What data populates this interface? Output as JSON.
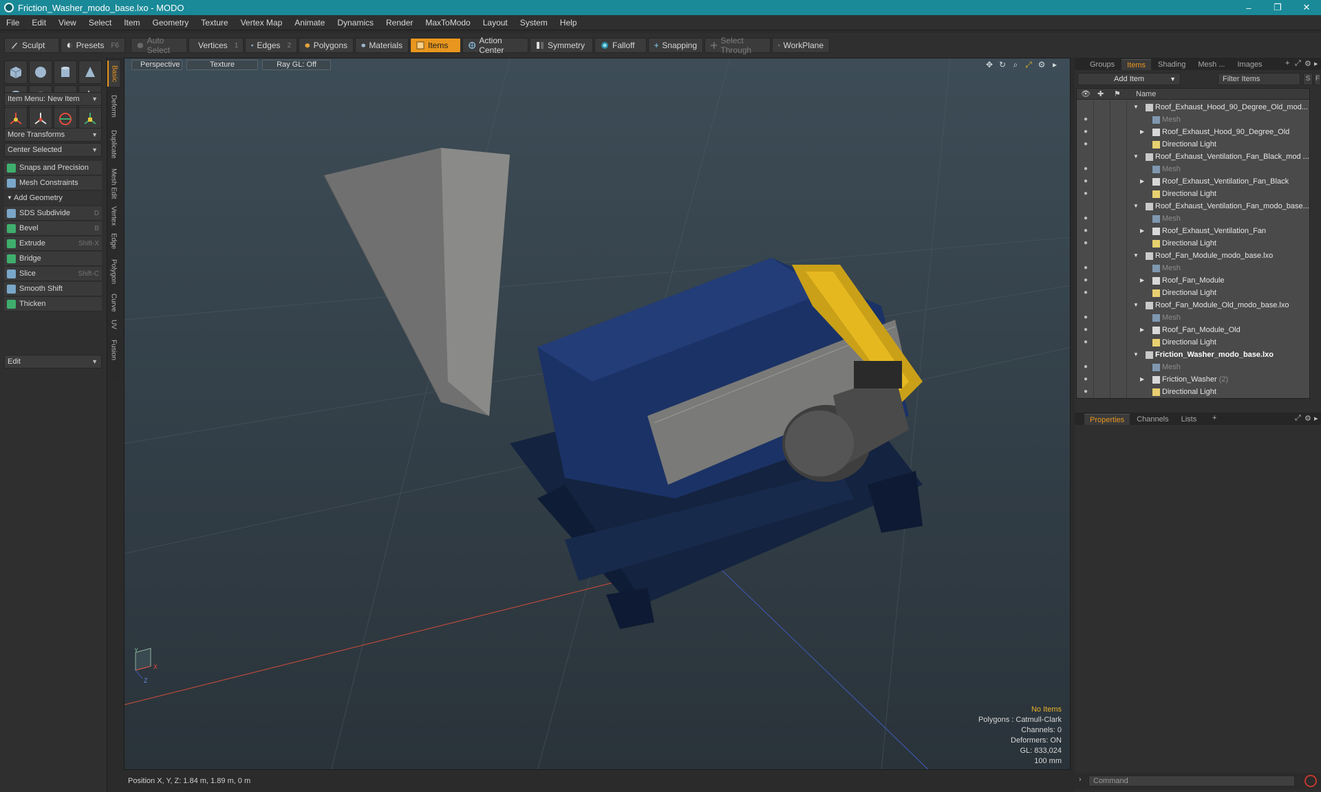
{
  "window": {
    "title": "Friction_Washer_modo_base.lxo - MODO",
    "minimize": "–",
    "maximize": "❐",
    "close": "✕"
  },
  "menus": [
    "File",
    "Edit",
    "View",
    "Select",
    "Item",
    "Geometry",
    "Texture",
    "Vertex Map",
    "Animate",
    "Dynamics",
    "Render",
    "MaxToModo",
    "Layout",
    "System",
    "Help"
  ],
  "toolbar": {
    "sculpt": "Sculpt",
    "presets": "Presets",
    "presets_key": "F6",
    "auto_select": "Auto Select",
    "vertices": "Vertices",
    "vertices_key": "1",
    "edges": "Edges",
    "edges_key": "2",
    "polygons": "Polygons",
    "materials": "Materials",
    "items": "Items",
    "action_center": "Action Center",
    "symmetry": "Symmetry",
    "falloff": "Falloff",
    "snapping": "Snapping",
    "select_through": "Select Through",
    "workplane": "WorkPlane"
  },
  "left": {
    "item_menu": "Item Menu: New Item",
    "more_transforms": "More Transforms",
    "center_selected": "Center Selected",
    "snaps": "Snaps and Precision",
    "mesh_constraints": "Mesh Constraints",
    "add_geometry": "Add Geometry",
    "tools": [
      {
        "label": "SDS Subdivide",
        "key": "D",
        "color": "#7aa7c9"
      },
      {
        "label": "Bevel",
        "key": "B",
        "color": "#3fae6d"
      },
      {
        "label": "Extrude",
        "key": "Shift-X",
        "color": "#3fae6d"
      },
      {
        "label": "Bridge",
        "key": "",
        "color": "#3fae6d"
      },
      {
        "label": "Slice",
        "key": "Shift-C",
        "color": "#7aa7c9"
      },
      {
        "label": "Smooth Shift",
        "key": "",
        "color": "#7aa7c9"
      },
      {
        "label": "Thicken",
        "key": "",
        "color": "#3fae6d"
      }
    ],
    "edit": "Edit"
  },
  "vtabs": [
    "Basic",
    "Deform",
    "Duplicate",
    "Mesh Edit",
    "Vertex",
    "Edge",
    "Polygon",
    "Curve",
    "UV",
    "Fusion"
  ],
  "viewport": {
    "perspective": "Perspective",
    "texture": "Texture",
    "raygl": "Ray GL: Off",
    "info": {
      "no_items": "No Items",
      "polygons": "Polygons : Catmull-Clark",
      "channels": "Channels: 0",
      "deformers": "Deformers: ON",
      "gl": "GL: 833,024",
      "scale": "100 mm"
    },
    "axis_y": "Y",
    "axis_x": "X",
    "axis_z": "Z"
  },
  "status": {
    "position": "Position X, Y, Z:   1.84 m, 1.89 m, 0 m"
  },
  "right": {
    "tabs": [
      "Groups",
      "Items",
      "Shading",
      "Mesh ...",
      "Images"
    ],
    "add_item": "Add Item",
    "filter_items": "Filter Items",
    "s_btn": "S",
    "f_btn": "F",
    "name_header": "Name",
    "rows": [
      {
        "name": "Roof_Exhaust_Hood_90_Degree_Old_mod...",
        "kind": "scene",
        "indent": 0,
        "tri": "▼"
      },
      {
        "name": "Mesh",
        "kind": "mesh",
        "indent": 1,
        "tri": ""
      },
      {
        "name": "Roof_Exhaust_Hood_90_Degree_Old",
        "kind": "group",
        "indent": 1,
        "tri": "▶"
      },
      {
        "name": "Directional Light",
        "kind": "light",
        "indent": 1,
        "tri": ""
      },
      {
        "name": "Roof_Exhaust_Ventilation_Fan_Black_mod ...",
        "kind": "scene",
        "indent": 0,
        "tri": "▼"
      },
      {
        "name": "Mesh",
        "kind": "mesh",
        "indent": 1,
        "tri": ""
      },
      {
        "name": "Roof_Exhaust_Ventilation_Fan_Black",
        "kind": "group",
        "indent": 1,
        "tri": "▶"
      },
      {
        "name": "Directional Light",
        "kind": "light",
        "indent": 1,
        "tri": ""
      },
      {
        "name": "Roof_Exhaust_Ventilation_Fan_modo_base...",
        "kind": "scene",
        "indent": 0,
        "tri": "▼"
      },
      {
        "name": "Mesh",
        "kind": "mesh",
        "indent": 1,
        "tri": ""
      },
      {
        "name": "Roof_Exhaust_Ventilation_Fan",
        "kind": "group",
        "indent": 1,
        "tri": "▶"
      },
      {
        "name": "Directional Light",
        "kind": "light",
        "indent": 1,
        "tri": ""
      },
      {
        "name": "Roof_Fan_Module_modo_base.lxo",
        "kind": "scene",
        "indent": 0,
        "tri": "▼"
      },
      {
        "name": "Mesh",
        "kind": "mesh",
        "indent": 1,
        "tri": ""
      },
      {
        "name": "Roof_Fan_Module",
        "kind": "group",
        "indent": 1,
        "tri": "▶"
      },
      {
        "name": "Directional Light",
        "kind": "light",
        "indent": 1,
        "tri": ""
      },
      {
        "name": "Roof_Fan_Module_Old_modo_base.lxo",
        "kind": "scene",
        "indent": 0,
        "tri": "▼"
      },
      {
        "name": "Mesh",
        "kind": "mesh",
        "indent": 1,
        "tri": ""
      },
      {
        "name": "Roof_Fan_Module_Old",
        "kind": "group",
        "indent": 1,
        "tri": "▶"
      },
      {
        "name": "Directional Light",
        "kind": "light",
        "indent": 1,
        "tri": ""
      },
      {
        "name": "Friction_Washer_modo_base.lxo",
        "kind": "scene",
        "indent": 0,
        "tri": "▼",
        "bold": true
      },
      {
        "name": "Mesh",
        "kind": "mesh",
        "indent": 1,
        "tri": ""
      },
      {
        "name": "Friction_Washer",
        "kind": "group",
        "indent": 1,
        "tri": "▶",
        "count": "(2)"
      },
      {
        "name": "Directional Light",
        "kind": "light",
        "indent": 1,
        "tri": ""
      }
    ],
    "prop_tabs": [
      "Properties",
      "Channels",
      "Lists"
    ],
    "command_placeholder": "Command"
  }
}
